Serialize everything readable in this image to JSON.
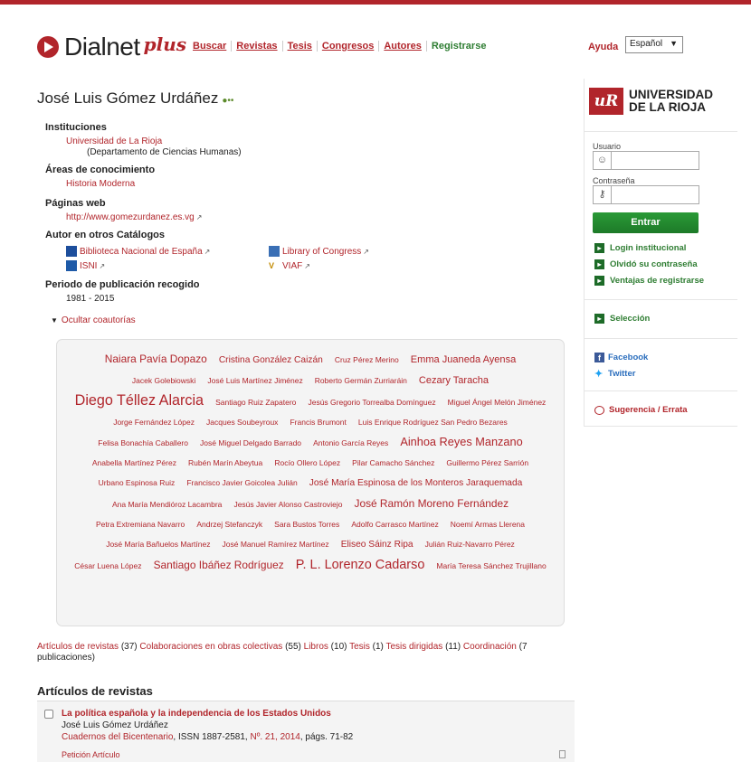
{
  "header": {
    "logo_text": "Dialnet",
    "logo_plus": "plus",
    "nav": [
      {
        "label": "Buscar"
      },
      {
        "label": "Revistas"
      },
      {
        "label": "Tesis"
      },
      {
        "label": "Congresos"
      },
      {
        "label": "Autores"
      },
      {
        "label": "Registrarse"
      }
    ],
    "help": "Ayuda",
    "language": "Español"
  },
  "author": {
    "name": "José Luis Gómez Urdáñez",
    "institutions_label": "Instituciones",
    "institution": "Universidad de La Rioja",
    "department": "(Departamento de Ciencias Humanas)",
    "areas_label": "Áreas de conocimiento",
    "area": "Historia Moderna",
    "web_label": "Páginas web",
    "web": "http://www.gomezurdanez.es.vg",
    "catalogs_label": "Autor en otros Catálogos",
    "catalogs": [
      "Biblioteca Nacional de España",
      "Library of Congress",
      "ISNI",
      "VIAF"
    ],
    "period_label": "Periodo de publicación recogido",
    "period": "1981 - 2015"
  },
  "coauthors_toggle": "Ocultar coautorías",
  "coauthors": [
    {
      "name": "Naiara Pavía Dopazo",
      "size": 14
    },
    {
      "name": "Cristina González Caizán",
      "size": 12
    },
    {
      "name": "Cruz Pérez Merino",
      "size": 10
    },
    {
      "name": "Emma Juaneda Ayensa",
      "size": 13
    },
    {
      "name": "Jacek Golebiowski",
      "size": 10
    },
    {
      "name": "José Luis Martínez Jiménez",
      "size": 10
    },
    {
      "name": "Roberto Germán Zurriaráin",
      "size": 10
    },
    {
      "name": "Cezary Taracha",
      "size": 13
    },
    {
      "name": "Diego Téllez Alarcia",
      "size": 19
    },
    {
      "name": "Santiago Ruiz Zapatero",
      "size": 10
    },
    {
      "name": "Jesús Gregorio Torrealba Domínguez",
      "size": 10
    },
    {
      "name": "Miguel Ángel Melón Jiménez",
      "size": 10
    },
    {
      "name": "Jorge Fernández López",
      "size": 10
    },
    {
      "name": "Jacques Soubeyroux",
      "size": 10
    },
    {
      "name": "Francis Brumont",
      "size": 10
    },
    {
      "name": "Luis Enrique Rodríguez San Pedro Bezares",
      "size": 10
    },
    {
      "name": "Felisa Bonachía Caballero",
      "size": 10
    },
    {
      "name": "José Miguel Delgado Barrado",
      "size": 10
    },
    {
      "name": "Antonio García Reyes",
      "size": 10
    },
    {
      "name": "Ainhoa Reyes Manzano",
      "size": 15
    },
    {
      "name": "Anabella Martínez Pérez",
      "size": 10
    },
    {
      "name": "Rubén Marín Abeytua",
      "size": 10
    },
    {
      "name": "Rocío Ollero López",
      "size": 10
    },
    {
      "name": "Pilar Camacho Sánchez",
      "size": 10
    },
    {
      "name": "Guillermo Pérez Sarrión",
      "size": 10
    },
    {
      "name": "Urbano Espinosa Ruiz",
      "size": 10
    },
    {
      "name": "Francisco Javier Goicolea Julián",
      "size": 10
    },
    {
      "name": "José María Espinosa de los Monteros Jaraquemada",
      "size": 12
    },
    {
      "name": "Ana María Mendióroz Lacambra",
      "size": 10
    },
    {
      "name": "Jesús Javier Alonso Castroviejo",
      "size": 10
    },
    {
      "name": "José Ramón Moreno Fernández",
      "size": 14
    },
    {
      "name": "Petra Extremiana Navarro",
      "size": 10
    },
    {
      "name": "Andrzej Stefanczyk",
      "size": 10
    },
    {
      "name": "Sara Bustos Torres",
      "size": 10
    },
    {
      "name": "Adolfo Carrasco Martínez",
      "size": 10
    },
    {
      "name": "Noemí Armas Llerena",
      "size": 10
    },
    {
      "name": "José María Bañuelos Martínez",
      "size": 10
    },
    {
      "name": "José Manuel Ramírez Martínez",
      "size": 10
    },
    {
      "name": "Eliseo Sáinz Ripa",
      "size": 12
    },
    {
      "name": "Julián Ruiz-Navarro Pérez",
      "size": 10
    },
    {
      "name": "César Luena López",
      "size": 10
    },
    {
      "name": "Santiago Ibáñez Rodríguez",
      "size": 14
    },
    {
      "name": "P. L. Lorenzo Cadarso",
      "size": 17
    },
    {
      "name": "María Teresa Sánchez Trujillano",
      "size": 10
    }
  ],
  "counts": {
    "journal_articles": "Artículos de revistas",
    "journal_articles_n": "(37)",
    "collective": "Colaboraciones en obras colectivas",
    "collective_n": "(55)",
    "books": "Libros",
    "books_n": "(10)",
    "theses": "Tesis",
    "theses_n": "(1)",
    "directed": "Tesis dirigidas",
    "directed_n": "(11)",
    "coordination": "Coordinación",
    "coordination_n": "(7 publicaciones)"
  },
  "articles_section": "Artículos de revistas",
  "article": {
    "title": "La política española y la independencia de los Estados Unidos",
    "author": "José Luis Gómez Urdáñez",
    "journal": "Cuadernos del Bicentenario",
    "issn": ", ISSN 1887-2581, ",
    "issue": "Nº. 21, 2014",
    "pages": ", págs. 71-82",
    "request": "Petición Artículo"
  },
  "sidebar": {
    "uni_mark": "uR",
    "uni_line1": "UNIVERSIDAD",
    "uni_line2": "DE LA RIOJA",
    "user_label": "Usuario",
    "password_label": "Contraseña",
    "login_button": "Entrar",
    "links": [
      "Login institucional",
      "Olvidó su contraseña",
      "Ventajas de registrarse"
    ],
    "selection": "Selección",
    "facebook": "Facebook",
    "twitter": "Twitter",
    "suggestion": "Sugerencia / Errata",
    "brand_red": "#b1252b",
    "brand_green": "#2e7d32"
  }
}
